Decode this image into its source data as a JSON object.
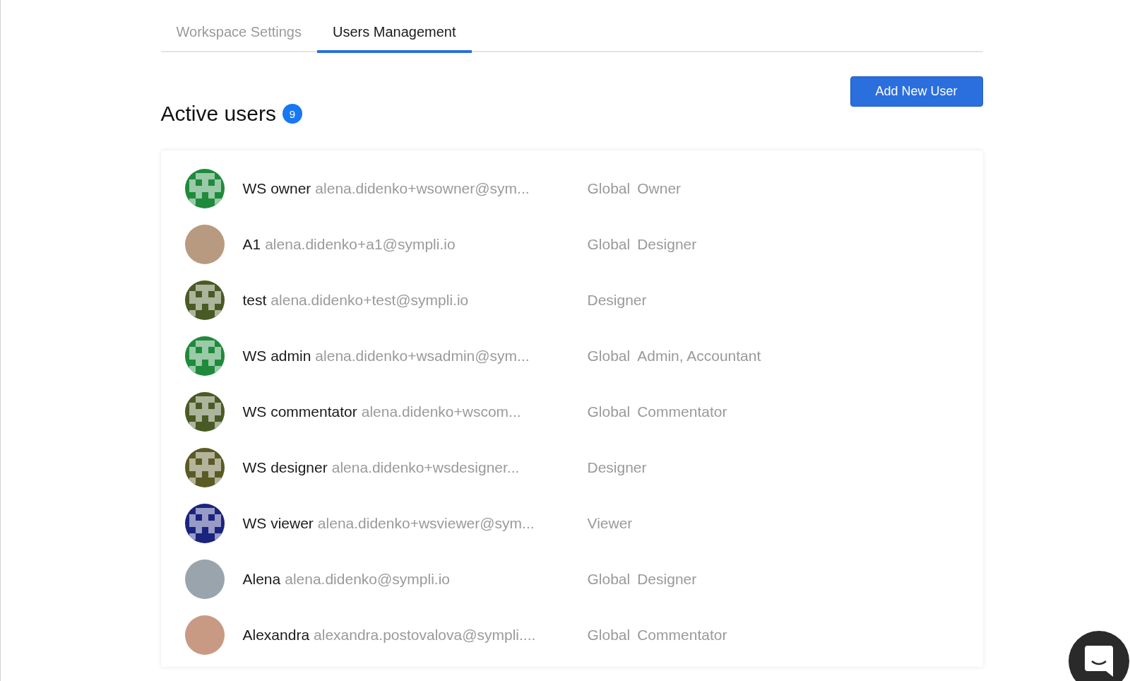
{
  "tabs": [
    {
      "label": "Workspace Settings",
      "selected": false
    },
    {
      "label": "Users Management",
      "selected": true
    }
  ],
  "add_button": "Add New User",
  "heading": {
    "title": "Active users",
    "count": "9"
  },
  "users": [
    {
      "name": "WS owner",
      "email": "alena.didenko+wsowner@sym...",
      "scope": "Global",
      "role": "Owner",
      "avatar": {
        "kind": "identicon",
        "color": "#1f8a3c"
      }
    },
    {
      "name": "A1",
      "email": "alena.didenko+a1@sympli.io",
      "scope": "Global",
      "role": "Designer",
      "avatar": {
        "kind": "photo",
        "color": "#b89a80"
      }
    },
    {
      "name": "test",
      "email": "alena.didenko+test@sympli.io",
      "role": "Designer",
      "avatar": {
        "kind": "identicon",
        "color": "#4a5a24"
      }
    },
    {
      "name": "WS admin",
      "email": "alena.didenko+wsadmin@sym...",
      "scope": "Global",
      "role": "Admin, Accountant",
      "avatar": {
        "kind": "identicon",
        "color": "#1f8a3c"
      }
    },
    {
      "name": "WS commentator",
      "email": "alena.didenko+wscom...",
      "scope": "Global",
      "role": "Commentator",
      "avatar": {
        "kind": "identicon",
        "color": "#4a5a24"
      }
    },
    {
      "name": "WS designer",
      "email": "alena.didenko+wsdesigner...",
      "role": "Designer",
      "avatar": {
        "kind": "identicon",
        "color": "#5a5a24"
      }
    },
    {
      "name": "WS viewer",
      "email": "alena.didenko+wsviewer@sym...",
      "role": "Viewer",
      "avatar": {
        "kind": "identicon",
        "color": "#1a237e"
      }
    },
    {
      "name": "Alena",
      "email": "alena.didenko@sympli.io",
      "scope": "Global",
      "role": "Designer",
      "avatar": {
        "kind": "photo",
        "color": "#9aa4ac"
      }
    },
    {
      "name": "Alexandra",
      "email": "alexandra.postovalova@sympli....",
      "scope": "Global",
      "role": "Commentator",
      "avatar": {
        "kind": "photo",
        "color": "#c89a84"
      }
    }
  ]
}
